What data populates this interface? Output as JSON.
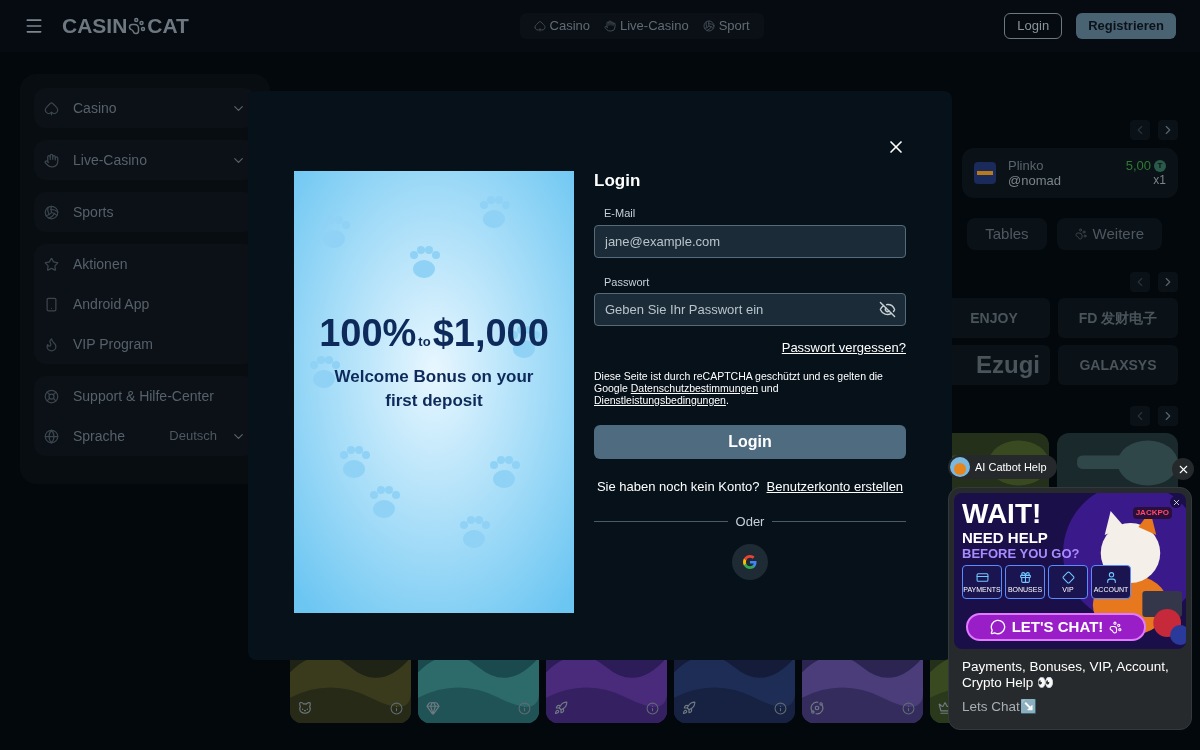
{
  "header": {
    "logo_left": "CASIN",
    "logo_right": "CAT",
    "nav": [
      {
        "label": "Casino"
      },
      {
        "label": "Live-Casino"
      },
      {
        "label": "Sport"
      }
    ],
    "login": "Login",
    "register": "Registrieren"
  },
  "sidebar": {
    "groups": [
      [
        {
          "label": "Casino",
          "dropdown": true
        }
      ],
      [
        {
          "label": "Live-Casino",
          "dropdown": true
        }
      ],
      [
        {
          "label": "Sports",
          "dropdown": false
        }
      ],
      [
        {
          "label": "Aktionen",
          "dropdown": false
        },
        {
          "label": "Android App",
          "dropdown": false
        },
        {
          "label": "VIP Program",
          "dropdown": false
        }
      ],
      [
        {
          "label": "Support & Hilfe-Center",
          "dropdown": false
        },
        {
          "label": "Sprache",
          "value": "Deutsch",
          "dropdown": true
        }
      ]
    ]
  },
  "recent_win": {
    "game": "Plinko",
    "user": "@nomad",
    "amount": "5,00",
    "currency": "T",
    "multiplier": "x1"
  },
  "category_tabs": [
    {
      "label": "Tables"
    },
    {
      "label": "Weitere"
    }
  ],
  "providers": [
    {
      "name": "ENJOY"
    },
    {
      "name": "FD 发财电子"
    },
    {
      "name": "Ezugi"
    },
    {
      "name": "GALAXSYS"
    }
  ],
  "login_dialog": {
    "bonus": {
      "percent": "100%",
      "to": "to",
      "amount": "$1,000",
      "caption": "Welcome Bonus on your first deposit"
    },
    "title": "Login",
    "email_label": "E-Mail",
    "email_placeholder": "jane@example.com",
    "password_label": "Passwort",
    "password_placeholder": "Geben Sie Ihr Passwort ein",
    "forgot": "Passwort vergessen?",
    "notice": [
      {
        "kind": "text",
        "text": "Diese Seite ist durch reCAPTCHA geschützt und es gelten die Google "
      },
      {
        "kind": "link",
        "text": "Datenschutzbestimmungen"
      },
      {
        "kind": "text",
        "text": " und "
      },
      {
        "kind": "link",
        "text": "Dienstleistungsbedingungen"
      },
      {
        "kind": "text",
        "text": "."
      }
    ],
    "submit": "Login",
    "signup_prompt": "Sie haben noch kein Konto?",
    "signup_link": "Benutzerkonto erstellen",
    "divider": "Oder"
  },
  "chat": {
    "bot_label": "AI Catbot Help",
    "banner": {
      "title": "WAIT!",
      "line_1": "NEED HELP",
      "line_2": "BEFORE YOU GO?",
      "topics": [
        "PAYMENTS",
        "BONUSES",
        "VIP",
        "ACCOUNT"
      ],
      "jackpot": "JACKPO",
      "cta": "LET'S CHAT!"
    },
    "message": "Payments, Bonuses, VIP, Account, Crypto Help 👀",
    "cta": "Lets Chat↘️"
  }
}
